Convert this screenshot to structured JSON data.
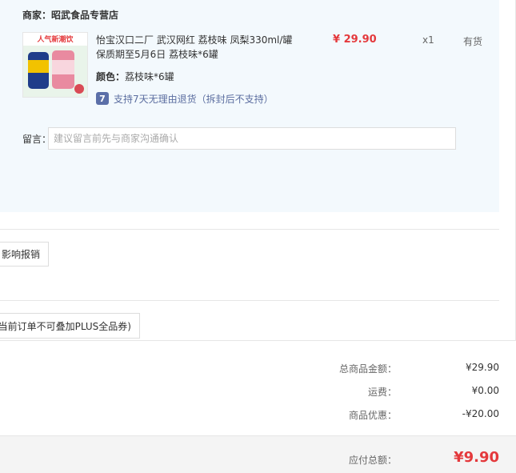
{
  "merchant": {
    "label": "商家：",
    "name": "昭武食品专营店"
  },
  "product": {
    "title": "怡宝汉口二厂 武汉网红 荔枝味 凤梨330ml/罐 保质期至5月6日 荔枝味*6罐",
    "price": "¥ 29.90",
    "quantity": "x1",
    "stock": "有货",
    "color_label": "颜色：",
    "color_value": "荔枝味*6罐",
    "return_badge": "7",
    "return_text": "支持7天无理由退货（拆封后不支持）",
    "thumb_text": "人气新潮饮"
  },
  "note": {
    "label": "留言：",
    "placeholder": "建议留言前先与商家沟通确认"
  },
  "invoice_button": "影响报销",
  "coupon_button": "当前订单不可叠加PLUS全品券)",
  "summary": [
    {
      "label": "总商品金额：",
      "value": "¥29.90"
    },
    {
      "label": "运费：",
      "value": "¥0.00"
    },
    {
      "label": "商品优惠：",
      "value": "-¥20.00"
    }
  ],
  "total": {
    "label": "应付总额：",
    "value": "¥9.90"
  },
  "colors": {
    "accent_red": "#e4393c",
    "panel_bg": "#f3f9fd",
    "badge_blue": "#5b6fa8"
  }
}
